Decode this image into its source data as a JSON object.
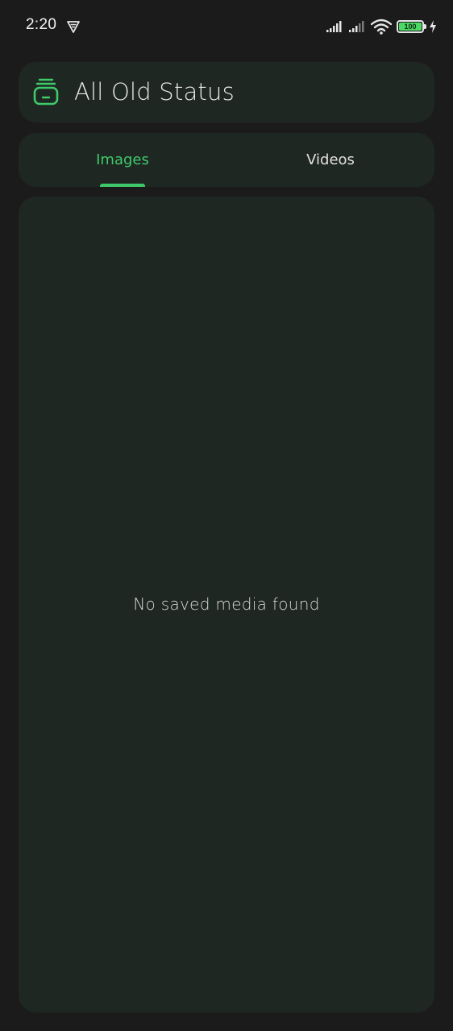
{
  "status_bar": {
    "time": "2:20",
    "battery_level": "100",
    "icons": [
      "vpn-icon",
      "signal-icon",
      "signal-icon",
      "wifi-icon",
      "battery-icon",
      "charging-icon"
    ]
  },
  "header": {
    "title": "All Old Status",
    "icon": "inbox-tray-icon"
  },
  "tabs": [
    {
      "label": "Images",
      "selected": true
    },
    {
      "label": "Videos",
      "selected": false
    }
  ],
  "content": {
    "empty_message": "No saved media found"
  },
  "colors": {
    "accent": "#3ec96a",
    "background": "#1b1b1b",
    "card": "#1f2723",
    "text": "#e8e8e8"
  }
}
